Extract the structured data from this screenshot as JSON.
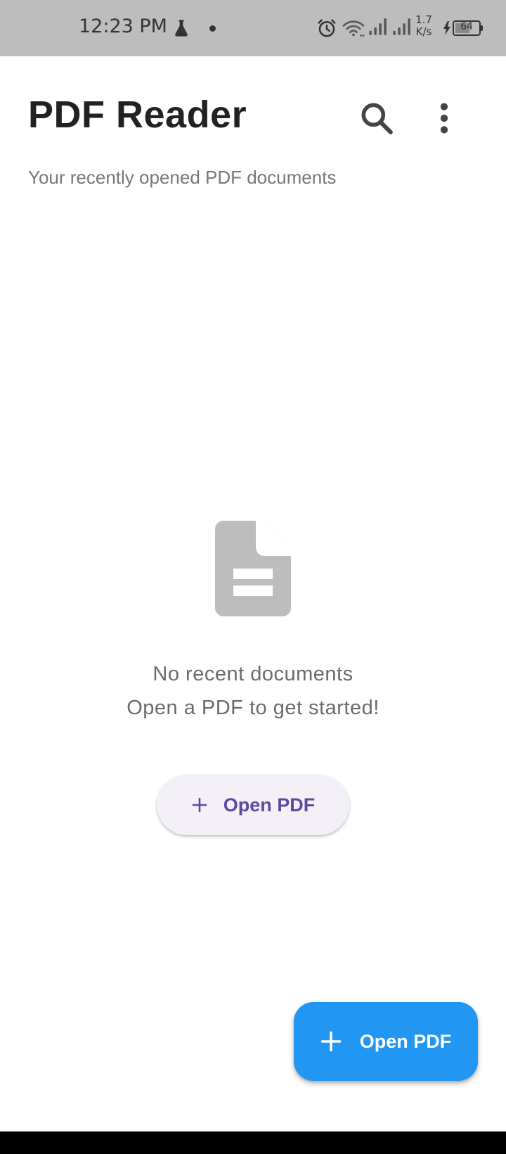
{
  "status_bar": {
    "time": "12:23 PM",
    "net_speed_value": "1.7",
    "net_speed_unit": "K/s",
    "battery_level": "64"
  },
  "header": {
    "title": "PDF Reader",
    "subtitle": "Your recently opened PDF documents",
    "search_icon": "search-icon",
    "more_icon": "more-vert-icon"
  },
  "empty_state": {
    "icon": "document-icon",
    "title": "No recent documents",
    "message": "Open a PDF to get started!",
    "button_label": "Open PDF"
  },
  "fab": {
    "label": "Open PDF",
    "icon": "plus-icon"
  },
  "colors": {
    "status_bar_bg": "#bdbdbd",
    "fab_bg": "#2196f3",
    "empty_button_text": "#5e4aa1",
    "empty_button_bg": "#f4f0f8",
    "empty_icon": "#bdbdbd"
  }
}
